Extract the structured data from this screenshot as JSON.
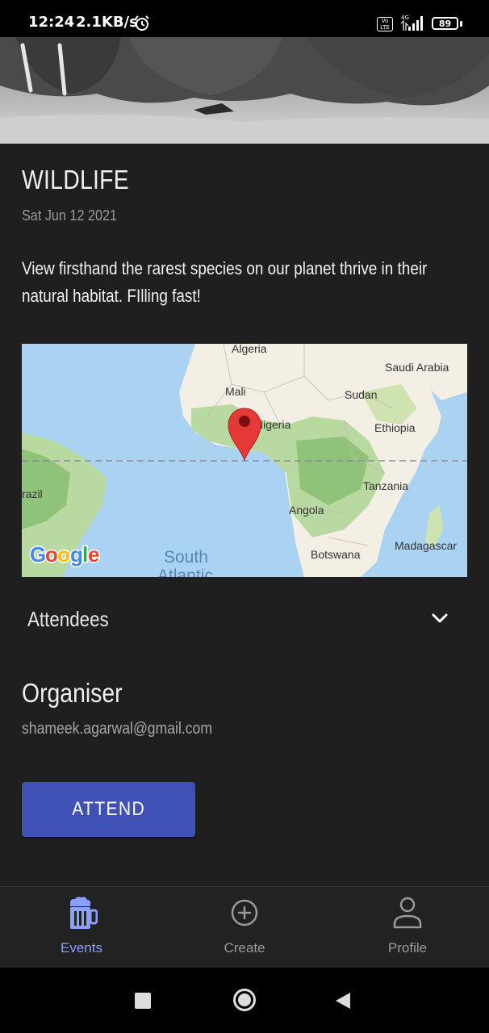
{
  "status_bar": {
    "time": "12:24",
    "speed": "2.1KB/s",
    "network_badge": "Vo LTE",
    "network_type": "4G",
    "battery": "89"
  },
  "event": {
    "title": "WILDLIFE",
    "date": "Sat Jun 12 2021",
    "description": "View firsthand the rarest species on our planet thrive in their natural habitat. FIlling fast!"
  },
  "map": {
    "labels": {
      "algeria": "Algeria",
      "saudi_arabia": "Saudi Arabia",
      "mali": "Mali",
      "sudan": "Sudan",
      "nigeria": "Nigeria",
      "ethiopia": "Ethiopia",
      "brazil": "razil",
      "tanzania": "Tanzania",
      "angola": "Angola",
      "madagascar": "Madagascar",
      "botswana": "Botswana",
      "south_atlantic": "South",
      "south_atlantic_2": "Atlantic",
      "google": "Google"
    },
    "pin_color": "#e53935"
  },
  "attendees": {
    "label": "Attendees"
  },
  "organiser": {
    "heading": "Organiser",
    "email": "shameek.agarwal@gmail.com"
  },
  "actions": {
    "attend_label": "ATTEND"
  },
  "bottom_nav": {
    "items": [
      {
        "label": "Events",
        "icon": "beer-mug-icon",
        "active": true
      },
      {
        "label": "Create",
        "icon": "add-circle-icon",
        "active": false
      },
      {
        "label": "Profile",
        "icon": "person-icon",
        "active": false
      }
    ]
  },
  "colors": {
    "background": "#1f1f1f",
    "accent": "#3f51b5",
    "nav_active": "#8c9eff"
  }
}
